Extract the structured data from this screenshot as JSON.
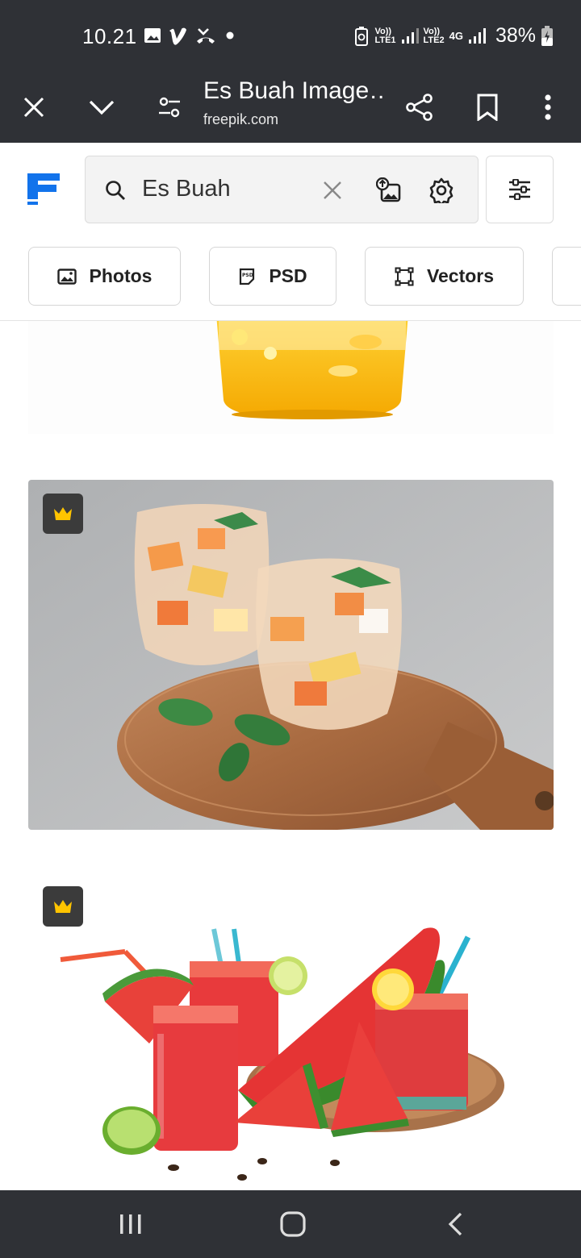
{
  "status_bar": {
    "time": "10.21",
    "sim1_label": "Vo))\nLTE1",
    "sim2_label": "Vo))\nLTE2",
    "sim2_network": "4G",
    "battery_percent": "38%",
    "icons": [
      "gallery-icon",
      "vimeo-icon",
      "missed-call-icon",
      "dot-icon",
      "battery-saver-icon",
      "signal-icon",
      "signal-icon",
      "battery-charging-icon"
    ]
  },
  "browser": {
    "page_title": "Es Buah Image…",
    "url": "freepik.com"
  },
  "search": {
    "query": "Es Buah"
  },
  "filter_chips": [
    {
      "label": "Photos",
      "icon": "image-icon"
    },
    {
      "label": "PSD",
      "icon": "psd-icon"
    },
    {
      "label": "Vectors",
      "icon": "vector-icon"
    }
  ],
  "results": [
    {
      "subject": "yellow-fruit-drink-cup",
      "premium": false
    },
    {
      "subject": "es-buah-glasses-on-wooden-board",
      "premium": true
    },
    {
      "subject": "watermelon-juice-glasses",
      "premium": true
    }
  ],
  "colors": {
    "chrome_bg": "#2f3136",
    "freepik_blue": "#1273eb",
    "premium_gold": "#ffc400"
  }
}
